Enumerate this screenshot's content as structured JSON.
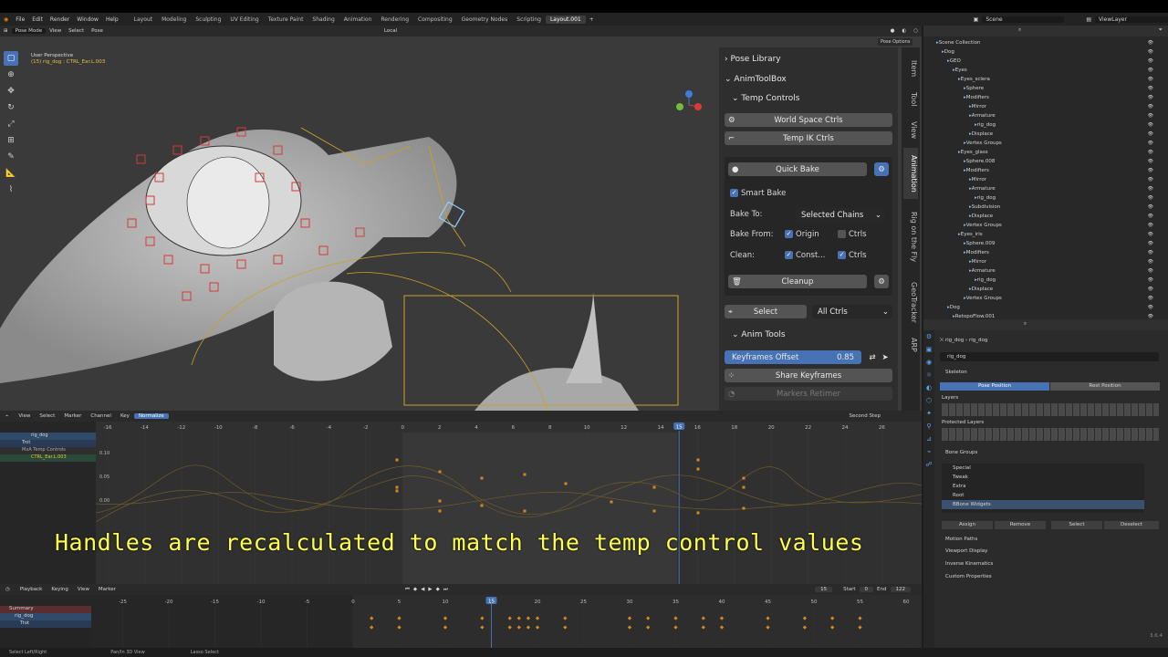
{
  "menu": [
    "File",
    "Edit",
    "Render",
    "Window",
    "Help"
  ],
  "workspaces": [
    "Layout",
    "Modeling",
    "Sculpting",
    "UV Editing",
    "Texture Paint",
    "Shading",
    "Animation",
    "Rendering",
    "Compositing",
    "Geometry Nodes",
    "Scripting",
    "Layout.001"
  ],
  "active_workspace": "Layout.001",
  "scene": "Scene",
  "view_layer": "ViewLayer",
  "viewport": {
    "mode": "Pose Mode",
    "menus": [
      "View",
      "Select",
      "Pose"
    ],
    "transform": "Local",
    "info_line1": "User Perspective",
    "info_line2": "(15) rig_dog : CTRL_Ear.L.003",
    "pose_options": "Pose Options"
  },
  "n_tabs": [
    "Item",
    "Tool",
    "View",
    "Animation",
    "Rig on the Fly",
    "GeoTracker",
    "ARP"
  ],
  "n_panel": {
    "pose_library": "Pose Library",
    "animtoolbox": "AnimToolBox",
    "temp_controls": "Temp Controls",
    "world_space": "World Space Ctrls",
    "temp_ik": "Temp IK Ctrls",
    "quick_bake": "Quick Bake",
    "smart_bake": "Smart Bake",
    "bake_to_label": "Bake To:",
    "bake_to_value": "Selected Chains",
    "bake_from_label": "Bake From:",
    "origin": "Origin",
    "ctrls": "Ctrls",
    "clean_label": "Clean:",
    "const": "Const...",
    "cleanup": "Cleanup",
    "select": "Select",
    "all_ctrls": "All Ctrls",
    "anim_tools": "Anim Tools",
    "keyframes_offset": "Keyframes Offset",
    "keyframes_offset_value": "0.85",
    "share_keyframes": "Share Keyframes",
    "markers_retimer": "Markers Retimer"
  },
  "outliner": {
    "rows": [
      "Scene Collection",
      "Dog",
      "GEO",
      "Eyes",
      "Eyes_sclera",
      "Sphere",
      "Modifiers",
      "Mirror",
      "Armature",
      "rig_dog",
      "Displace",
      "Vertex Groups",
      "Eyes_glass",
      "Sphere.008",
      "Modifiers",
      "Mirror",
      "Armature",
      "rig_dog",
      "Subdivision",
      "Displace",
      "Vertex Groups",
      "Eyes_iris",
      "Sphere.009",
      "Modifiers",
      "Mirror",
      "Armature",
      "rig_dog",
      "Displace",
      "Vertex Groups",
      "Dog",
      "RetopoFlow.001"
    ]
  },
  "properties": {
    "breadcrumb1": "rig_dog",
    "breadcrumb2": "rig_dog",
    "name": "rig_dog",
    "skeleton": "Skeleton",
    "pose_position": "Pose Position",
    "rest_position": "Rest Position",
    "layers": "Layers",
    "protected_layers": "Protected Layers",
    "bone_groups": "Bone Groups",
    "groups": [
      "Special",
      "Tweak",
      "Extra",
      "Root",
      "BBone Widgets"
    ],
    "assign": "Assign",
    "remove": "Remove",
    "select": "Select",
    "deselect": "Deselect",
    "sections": [
      "Motion Paths",
      "Viewport Display",
      "Inverse Kinematics",
      "Custom Properties"
    ],
    "version": "3.6.4"
  },
  "graph_editor": {
    "menus": [
      "View",
      "Select",
      "Marker",
      "Channel",
      "Key"
    ],
    "normalize": "Normalize",
    "step": "Second Step",
    "ruler": [
      "-16",
      "-14",
      "-12",
      "-10",
      "-8",
      "-6",
      "-4",
      "-2",
      "0",
      "2",
      "4",
      "6",
      "8",
      "10",
      "12",
      "14",
      "15",
      "16",
      "18",
      "20",
      "22",
      "24",
      "26"
    ],
    "current_frame": "15",
    "values": [
      "0.10",
      "0.05",
      "0.00"
    ],
    "channels": [
      "rig_dog",
      "Trot",
      "MxA Temp Controls",
      "CTRL_Ear.L.003"
    ]
  },
  "timeline": {
    "menus": [
      "Playback",
      "Keying",
      "View",
      "Marker"
    ],
    "current": "15",
    "start_label": "Start",
    "start": "0",
    "end_label": "End",
    "end": "122",
    "ruler": [
      "-25",
      "-20",
      "-15",
      "-10",
      "-5",
      "0",
      "5",
      "10",
      "15",
      "20",
      "25",
      "30",
      "35",
      "40",
      "45",
      "50",
      "55",
      "60"
    ],
    "channels": [
      "Summary",
      "rig_dog",
      "Trot"
    ]
  },
  "status": [
    "Select Left/Right",
    "Pan/In 3D View",
    "Lasso Select"
  ],
  "subtitle": "Handles are recalculated to match the temp control values",
  "colors": {
    "accent": "#4772b3",
    "subtitle": "#ffff4d",
    "bone_red": "#d23a3a",
    "bone_yellow": "#c9a227"
  }
}
